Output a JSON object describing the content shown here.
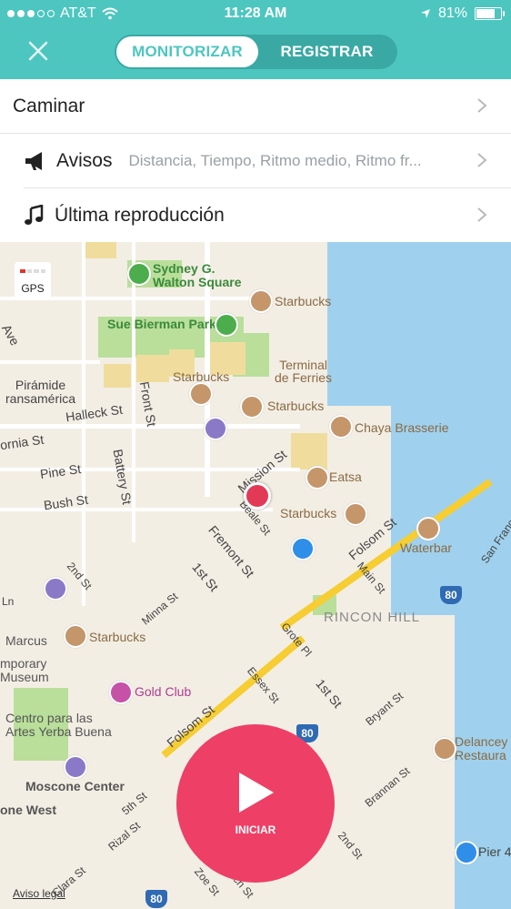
{
  "status_bar": {
    "carrier": "AT&T",
    "time": "11:28 AM",
    "battery": "81%"
  },
  "header": {
    "segments": [
      {
        "label": "MONITORIZAR",
        "active": true
      },
      {
        "label": "REGISTRAR",
        "active": false
      }
    ]
  },
  "list": {
    "activity": "Caminar",
    "alerts_label": "Avisos",
    "alerts_value": "Distancia, Tiempo, Ritmo medio, Ritmo fr...",
    "music_label": "Última reproducción"
  },
  "map": {
    "gps_label": "GPS",
    "legal_label": "Aviso legal",
    "labels": {
      "sydney": "Sydney G.\nWalton Square",
      "bierman": "Sue Bierman Park",
      "terminal": "Terminal\nde Ferries",
      "starbucks1": "Starbucks",
      "starbucks2": "Starbucks",
      "starbucks3": "Starbucks",
      "starbucks4": "Starbucks",
      "starbucks5": "Starbucks",
      "chaya": "Chaya Brasserie",
      "eatsa": "Eatsa",
      "waterbar": "Waterbar",
      "rincon": "RINCON HILL",
      "gold": "Gold Club",
      "moscone": "Moscone Center",
      "moscone_west": "one West",
      "centro": "Centro para las\nArtes Yerba Buena",
      "museum": "mporary\nMuseum",
      "marcus": "Marcus",
      "piramide": "Pirámide\nransamérica",
      "delancey": "Delancey\nRestaura",
      "pier": "Pier 4",
      "ave": "Ave",
      "halleck": "Halleck St",
      "front": "Front St",
      "fornia": "ornia St",
      "pine": "Pine St",
      "battery": "Battery St",
      "bush": "Bush St",
      "mission": "Mission St",
      "beale": "Beale St",
      "fremont": "Fremont St",
      "folsom1": "Folsom St",
      "folsom2": "Folsom St",
      "second": "2nd St",
      "first": "1st St",
      "first2": "1st St",
      "minna": "Minna St",
      "main": "Main St",
      "grote": "Grote Pl",
      "essex": "Essex St",
      "bryant": "Bryant St",
      "brannan": "Brannan St",
      "second2": "2nd St",
      "rizal": "Rizal St",
      "zoe": "Zoe St",
      "ritch": "Ritch St",
      "clara": "Clara St",
      "fifth": "5th St",
      "ln": "Ln",
      "hwy80": "80",
      "sanfran": "San Franc"
    }
  },
  "start_button": {
    "label": "INICIAR"
  },
  "colors": {
    "teal": "#4dc6c0",
    "accent": "#ee3f66"
  }
}
